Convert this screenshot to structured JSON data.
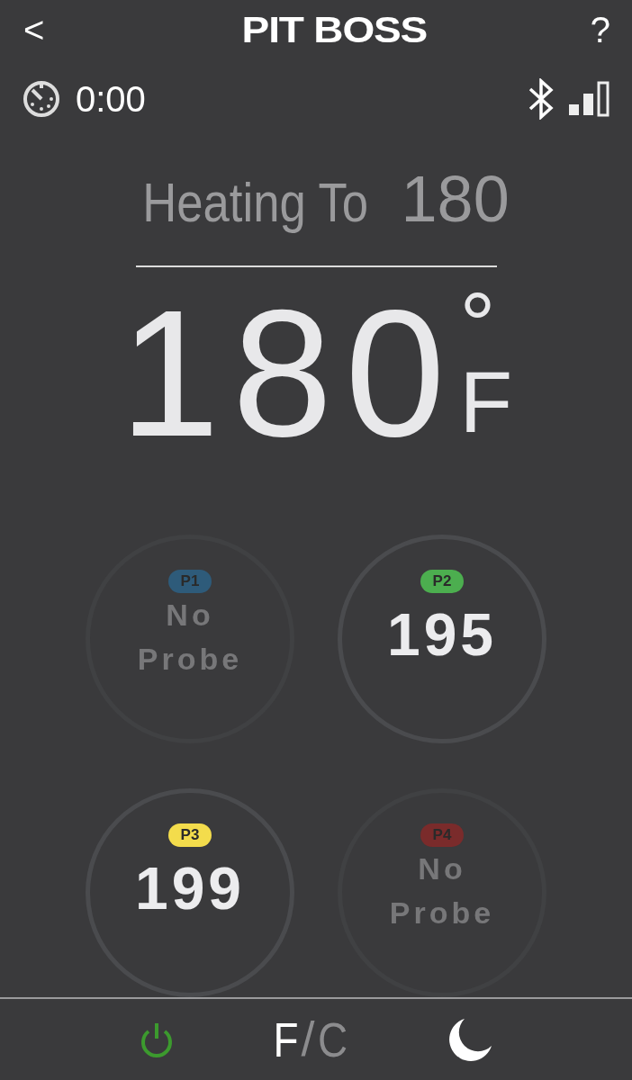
{
  "header": {
    "back": "<",
    "logo": "PIT BOSS",
    "help": "?"
  },
  "status": {
    "timer": "0:00"
  },
  "heating": {
    "label": "Heating To",
    "target": "180"
  },
  "temperature": {
    "value": "180",
    "degree": "°",
    "unit": "F"
  },
  "probes": [
    {
      "label": "P1",
      "color": "#2e5b7a",
      "connected": false,
      "reading": "No Probe"
    },
    {
      "label": "P2",
      "color": "#4cae4f",
      "connected": true,
      "reading": "195"
    },
    {
      "label": "P3",
      "color": "#f3dc4c",
      "connected": true,
      "reading": "199"
    },
    {
      "label": "P4",
      "color": "#7a2b2b",
      "connected": false,
      "reading": "No Probe"
    }
  ],
  "units": {
    "options": [
      {
        "label": "F",
        "selected": true
      },
      {
        "label": "C",
        "selected": false
      }
    ],
    "separator": "/"
  },
  "power": {
    "on": true
  }
}
